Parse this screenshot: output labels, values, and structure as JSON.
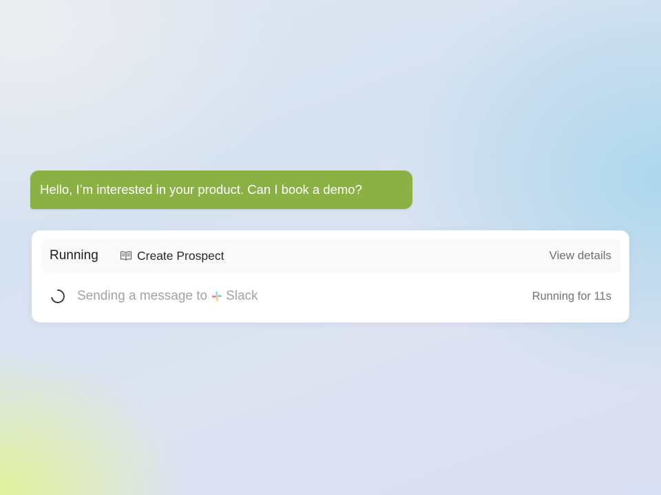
{
  "chat": {
    "user_message": "Hello, I’m interested in your product. Can I book a demo?"
  },
  "run": {
    "status": "Running",
    "flow_icon": "book-open-icon",
    "flow_name": "Create Prospect",
    "view_details_label": "View details",
    "task": {
      "status_icon": "spinner-icon",
      "prefix": "Sending a message to",
      "integration_icon": "slack-icon",
      "integration": "Slack",
      "elapsed": "Running for 11s"
    }
  },
  "colors": {
    "bubble": "#8bb043",
    "card": "#ffffff",
    "muted_text": "#a3a3a3",
    "slack_blue": "#36c5f0",
    "slack_green": "#2eb67d",
    "slack_yellow": "#ecb22e",
    "slack_red": "#e01e5a"
  }
}
